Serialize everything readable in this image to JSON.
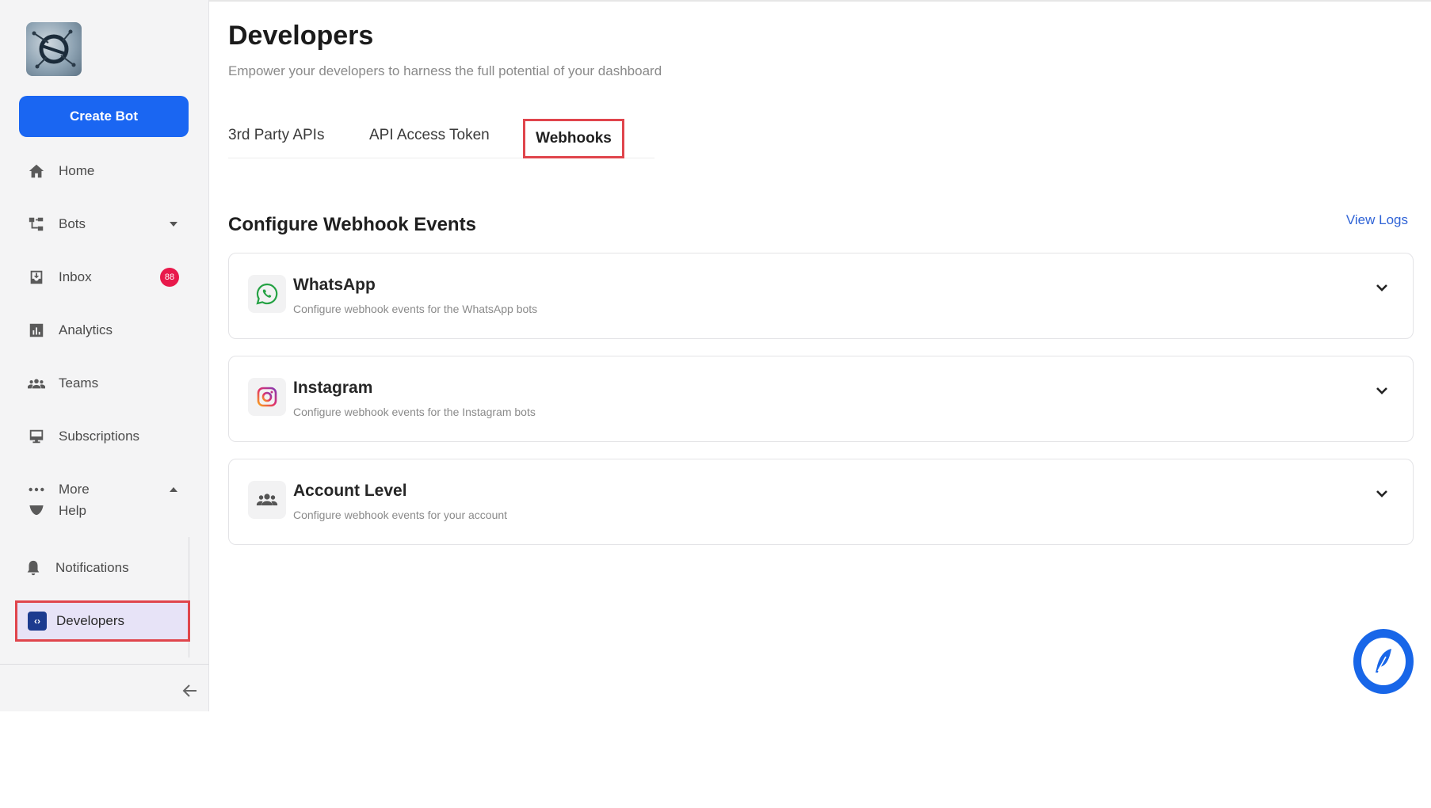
{
  "sidebar": {
    "create_bot": "Create Bot",
    "items": [
      {
        "label": "Home",
        "icon": "home-icon"
      },
      {
        "label": "Bots",
        "icon": "bots-icon"
      },
      {
        "label": "Inbox",
        "icon": "inbox-icon",
        "badge": "88"
      },
      {
        "label": "Analytics",
        "icon": "analytics-icon"
      },
      {
        "label": "Teams",
        "icon": "teams-icon"
      },
      {
        "label": "Subscriptions",
        "icon": "subscriptions-icon"
      },
      {
        "label": "More",
        "icon": "more-icon"
      },
      {
        "label": "Help",
        "icon": "help-icon"
      },
      {
        "label": "Notifications",
        "icon": "bell-icon"
      },
      {
        "label": "Developers",
        "icon": "code-icon"
      }
    ]
  },
  "header": {
    "title": "Developers",
    "subtitle": "Empower your developers to harness the full potential of your dashboard"
  },
  "tabs": [
    {
      "label": "3rd Party APIs"
    },
    {
      "label": "API Access Token"
    },
    {
      "label": "Webhooks"
    }
  ],
  "section": {
    "title": "Configure Webhook Events",
    "view_logs": "View Logs"
  },
  "cards": [
    {
      "title": "WhatsApp",
      "desc": "Configure webhook events for the WhatsApp bots",
      "icon": "whatsapp-icon"
    },
    {
      "title": "Instagram",
      "desc": "Configure webhook events for the Instagram bots",
      "icon": "instagram-icon"
    },
    {
      "title": "Account Level",
      "desc": "Configure webhook events for your account",
      "icon": "account-icon"
    }
  ],
  "colors": {
    "primary": "#1a66f2",
    "highlight": "#e0454c",
    "badge": "#e8194b",
    "link": "#2f63d6"
  }
}
